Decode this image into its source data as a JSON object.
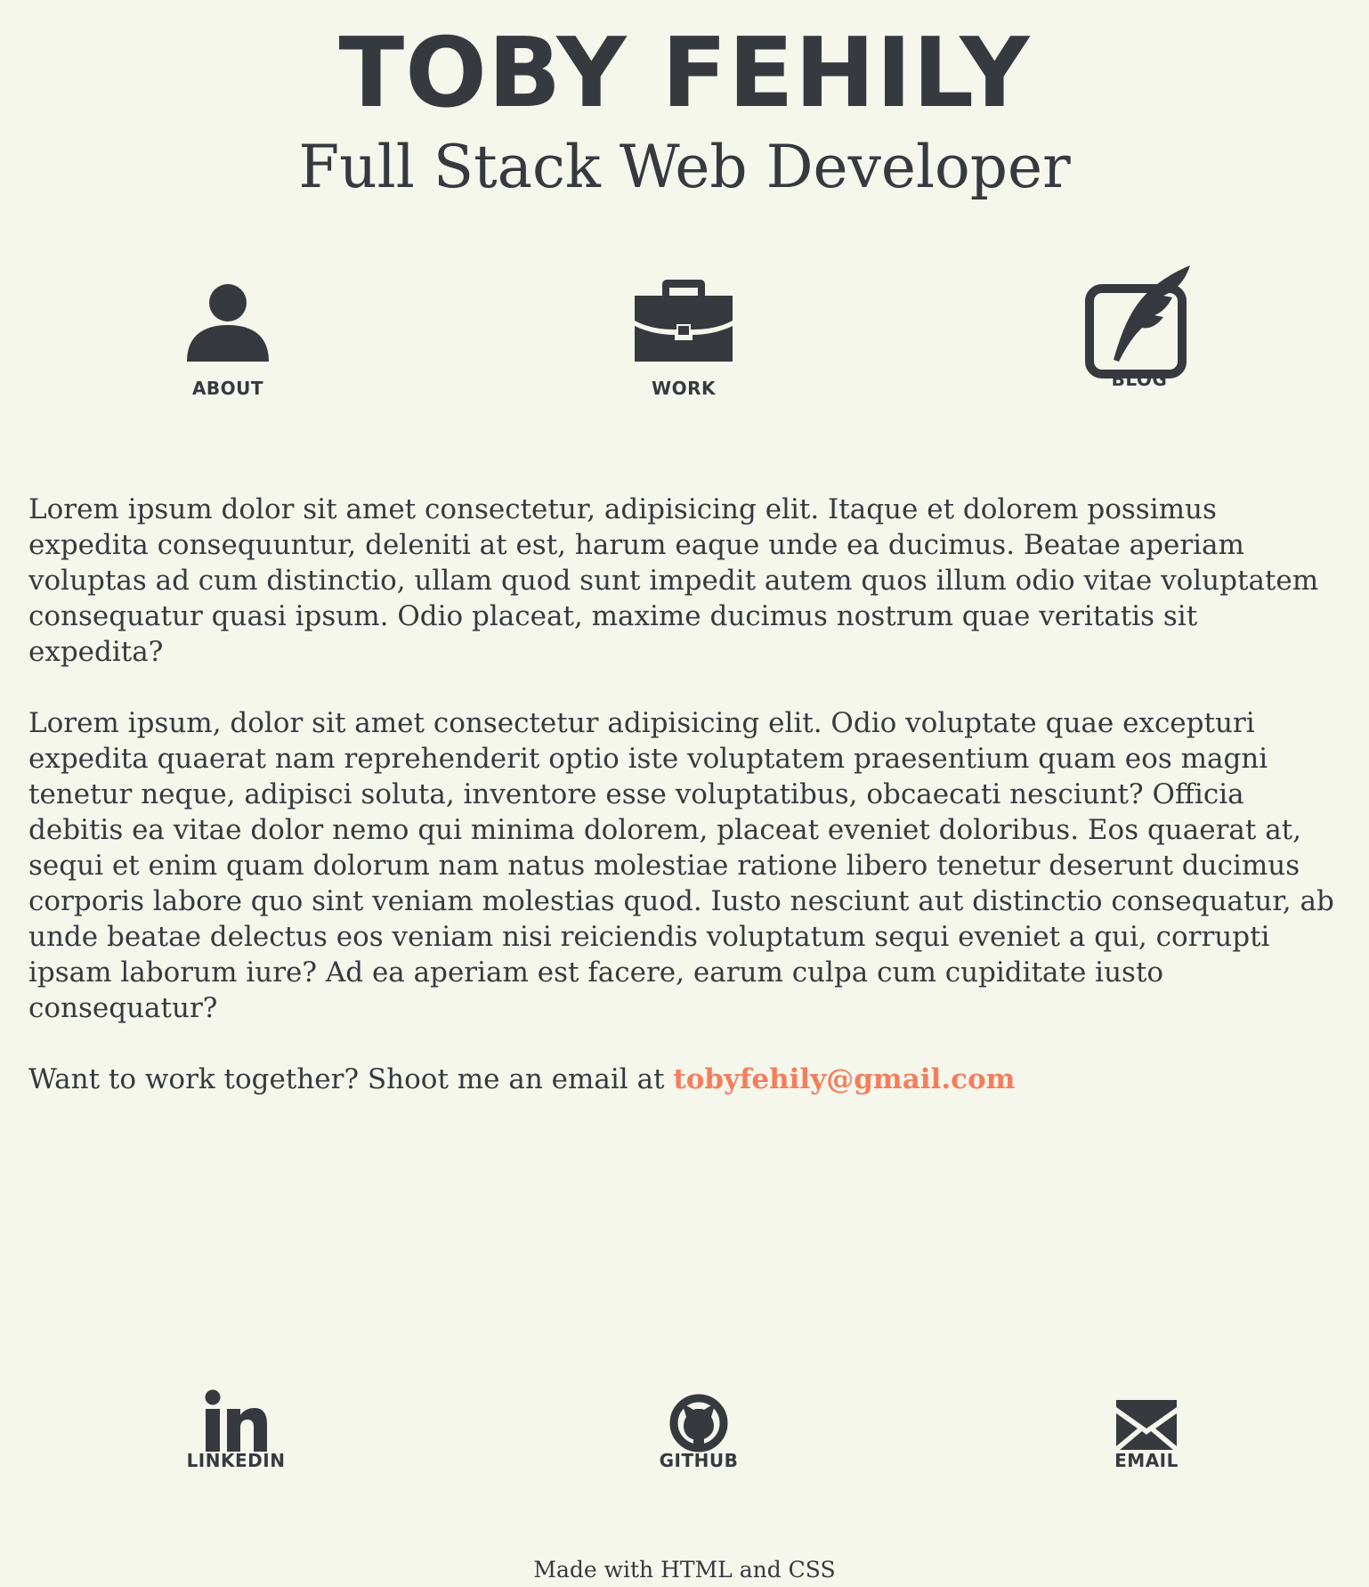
{
  "header": {
    "name": "TOBY FEHILY",
    "tagline": "Full Stack Web Developer"
  },
  "nav": {
    "items": [
      {
        "label": "ABOUT",
        "icon": "user-icon"
      },
      {
        "label": "WORK",
        "icon": "briefcase-icon"
      },
      {
        "label": "BLOG",
        "icon": "quill-edit-icon"
      }
    ]
  },
  "content": {
    "paragraphs": [
      "Lorem ipsum dolor sit amet consectetur, adipisicing elit. Itaque et dolorem possimus expedita consequuntur, deleniti at est, harum eaque unde ea ducimus. Beatae aperiam voluptas ad cum distinctio, ullam quod sunt impedit autem quos illum odio vitae voluptatem consequatur quasi ipsum. Odio placeat, maxime ducimus nostrum quae veritatis sit expedita?",
      "Lorem ipsum, dolor sit amet consectetur adipisicing elit. Odio voluptate quae excepturi expedita quaerat nam reprehenderit optio iste voluptatem praesentium quam eos magni tenetur neque, adipisci soluta, inventore esse voluptatibus, obcaecati nesciunt? Officia debitis ea vitae dolor nemo qui minima dolorem, placeat eveniet doloribus. Eos quaerat at, sequi et enim quam dolorum nam natus molestiae ratione libero tenetur deserunt ducimus corporis labore quo sint veniam molestias quod. Iusto nesciunt aut distinctio consequatur, ab unde beatae delectus eos veniam nisi reiciendis voluptatum sequi eveniet a qui, corrupti ipsam laborum iure? Ad ea aperiam est facere, earum culpa cum cupiditate iusto consequatur?"
    ],
    "contact_prefix": "Want to work together? Shoot me an email at ",
    "contact_email": "tobyfehily@gmail.com"
  },
  "social": {
    "items": [
      {
        "label": "LINKEDIN",
        "icon": "linkedin-icon"
      },
      {
        "label": "GITHUB",
        "icon": "github-icon"
      },
      {
        "label": "EMAIL",
        "icon": "envelope-icon"
      }
    ]
  },
  "footer": {
    "credit": "Made with HTML and CSS"
  },
  "colors": {
    "background": "#f5f6ec",
    "text": "#363a3e",
    "accent": "#f47e5c"
  }
}
